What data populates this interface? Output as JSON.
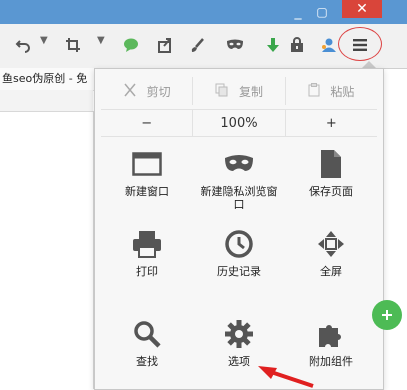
{
  "titlebar": {
    "minimize_glyph": "_",
    "maximize_glyph": "▢",
    "close_glyph": "✕",
    "accent": "#5a97d2"
  },
  "toolbar": {
    "icons": [
      "undo-icon",
      "dropdown-icon",
      "crop-icon",
      "dropdown-icon",
      "chat-icon",
      "share-icon",
      "brush-icon",
      "mask-icon",
      "download-icon",
      "lock-icon",
      "user-icon",
      "menu-icon"
    ]
  },
  "tab": {
    "title": "鱼seo伪原创 - 免"
  },
  "menu": {
    "edit": {
      "cut": "剪切",
      "copy": "复制",
      "paste": "粘贴"
    },
    "zoom": {
      "minus": "−",
      "level": "100%",
      "plus": "+"
    },
    "items": {
      "new_window": "新建窗口",
      "new_private": "新建隐私浏览窗口",
      "save_page": "保存页面",
      "print": "打印",
      "history": "历史记录",
      "fullscreen": "全屏",
      "find": "查找",
      "options": "选项",
      "addons": "附加组件"
    }
  },
  "colors": {
    "highlight": "#dd4444",
    "arrow": "#e02020"
  }
}
